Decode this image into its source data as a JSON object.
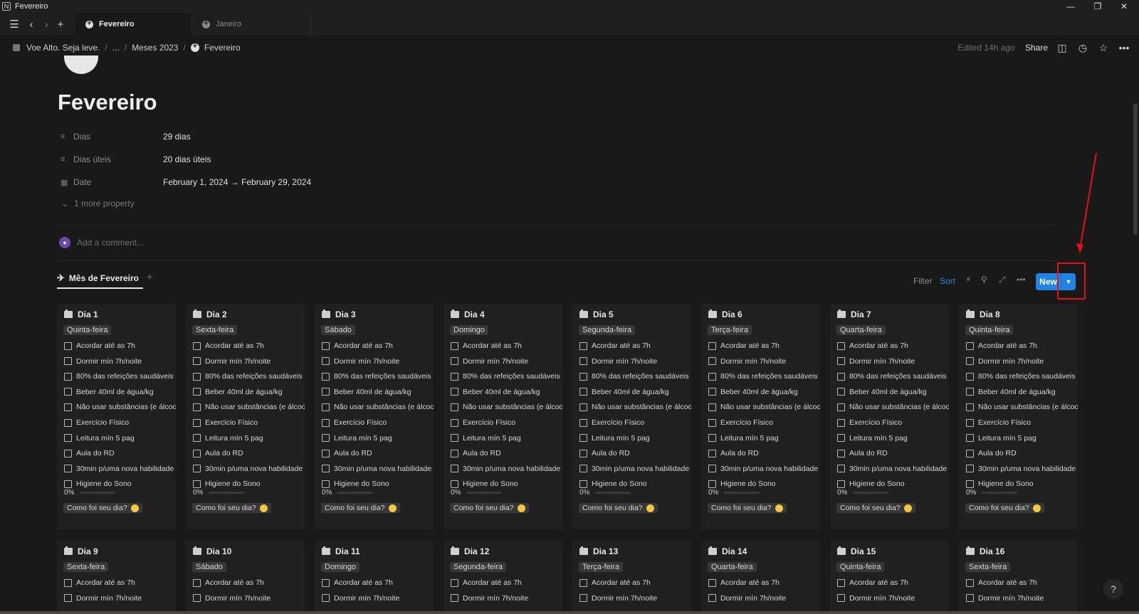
{
  "window": {
    "title": "Fevereiro",
    "app_icon": "N"
  },
  "tabs": [
    {
      "label": "Fevereiro",
      "active": true
    },
    {
      "label": "Janeiro",
      "active": false
    }
  ],
  "breadcrumb": {
    "workspace": "Voe Alto. Seja leve.",
    "ellipsis": "...",
    "parent": "Meses 2023",
    "current": "Fevereiro"
  },
  "topbar": {
    "edited": "Edited 14h ago",
    "share": "Share"
  },
  "page": {
    "title": "Fevereiro",
    "properties": [
      {
        "name": "Dias",
        "value": "29 dias",
        "icon": "text-lines-icon"
      },
      {
        "name": "Dias úteis",
        "value": "20 dias úteis",
        "icon": "text-lines-icon"
      },
      {
        "name": "Date",
        "value": "February 1, 2024 → February 29, 2024",
        "icon": "calendar-icon"
      }
    ],
    "more_property": "1 more property",
    "comment_placeholder": "Add a comment..."
  },
  "database": {
    "view_name": "Mês de Fevereiro",
    "filter": "Filter",
    "sort": "Sort",
    "new": "New"
  },
  "card_common": {
    "todos": [
      "Acordar até as 7h",
      "Dormir mín 7h/noite",
      "80% das refeições saudáveis",
      "Beber 40ml de água/kg",
      "Não usar substâncias (e álcool)",
      "Exercício Físico",
      "Leitura mín 5 pag",
      "Aula do RD",
      "30min p/uma nova habilidade",
      "Higiene do Sono"
    ],
    "progress": "0%",
    "progress_fraction": 0,
    "how_was": "Como foi seu dia?"
  },
  "cards_row1": [
    {
      "title": "Dia 1",
      "weekday": "Quinta-feira"
    },
    {
      "title": "Dia 2",
      "weekday": "Sexta-feira"
    },
    {
      "title": "Dia 3",
      "weekday": "Sábado"
    },
    {
      "title": "Dia 4",
      "weekday": "Domingo"
    },
    {
      "title": "Dia 5",
      "weekday": "Segunda-feira"
    },
    {
      "title": "Dia 6",
      "weekday": "Terça-feira"
    },
    {
      "title": "Dia 7",
      "weekday": "Quarta-feira"
    },
    {
      "title": "Dia 8",
      "weekday": "Quinta-feira"
    }
  ],
  "cards_row2": [
    {
      "title": "Dia 9",
      "weekday": "Sexta-feira"
    },
    {
      "title": "Dia 10",
      "weekday": "Sábado"
    },
    {
      "title": "Dia 11",
      "weekday": "Domingo"
    },
    {
      "title": "Dia 12",
      "weekday": "Segunda-feira"
    },
    {
      "title": "Dia 13",
      "weekday": "Terça-feira"
    },
    {
      "title": "Dia 14",
      "weekday": "Quarta-feira"
    },
    {
      "title": "Dia 15",
      "weekday": "Quinta-feira"
    },
    {
      "title": "Dia 16",
      "weekday": "Sexta-feira"
    }
  ],
  "colors": {
    "accent": "#2383e2",
    "annotation": "#e01414",
    "background": "#191919"
  }
}
